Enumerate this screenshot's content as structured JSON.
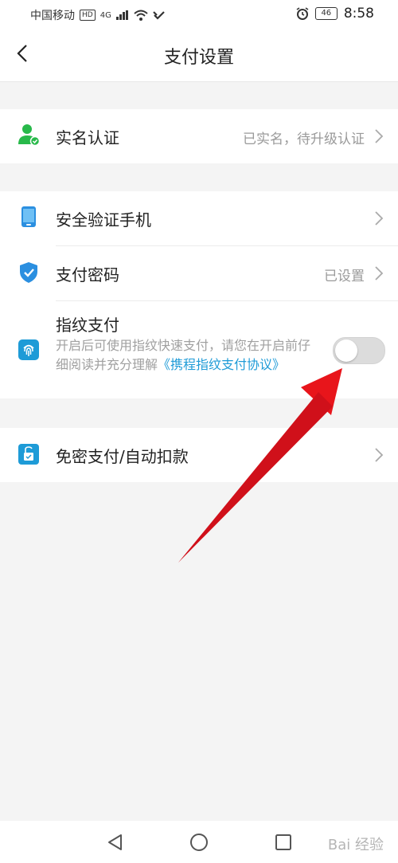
{
  "status_bar": {
    "carrier": "中国移动",
    "hd": "HD",
    "network": "4G",
    "battery": "46",
    "time": "8:58"
  },
  "header": {
    "title": "支付设置"
  },
  "rows": {
    "realname": {
      "title": "实名认证",
      "value": "已实名，待升级认证"
    },
    "phone": {
      "title": "安全验证手机"
    },
    "password": {
      "title": "支付密码",
      "value": "已设置"
    },
    "fingerprint": {
      "title": "指纹支付",
      "desc_plain": "开启后可使用指纹快速支付，请您在开启前仔细阅读并充分理解",
      "desc_link": "《携程指纹支付协议》",
      "enabled": false
    },
    "nopwd": {
      "title": "免密支付/自动扣款"
    }
  },
  "watermark": "Bai 经验",
  "colors": {
    "accent_blue": "#1e9bd7",
    "icon_green": "#28b94a",
    "annotation_red": "#e8151b"
  }
}
